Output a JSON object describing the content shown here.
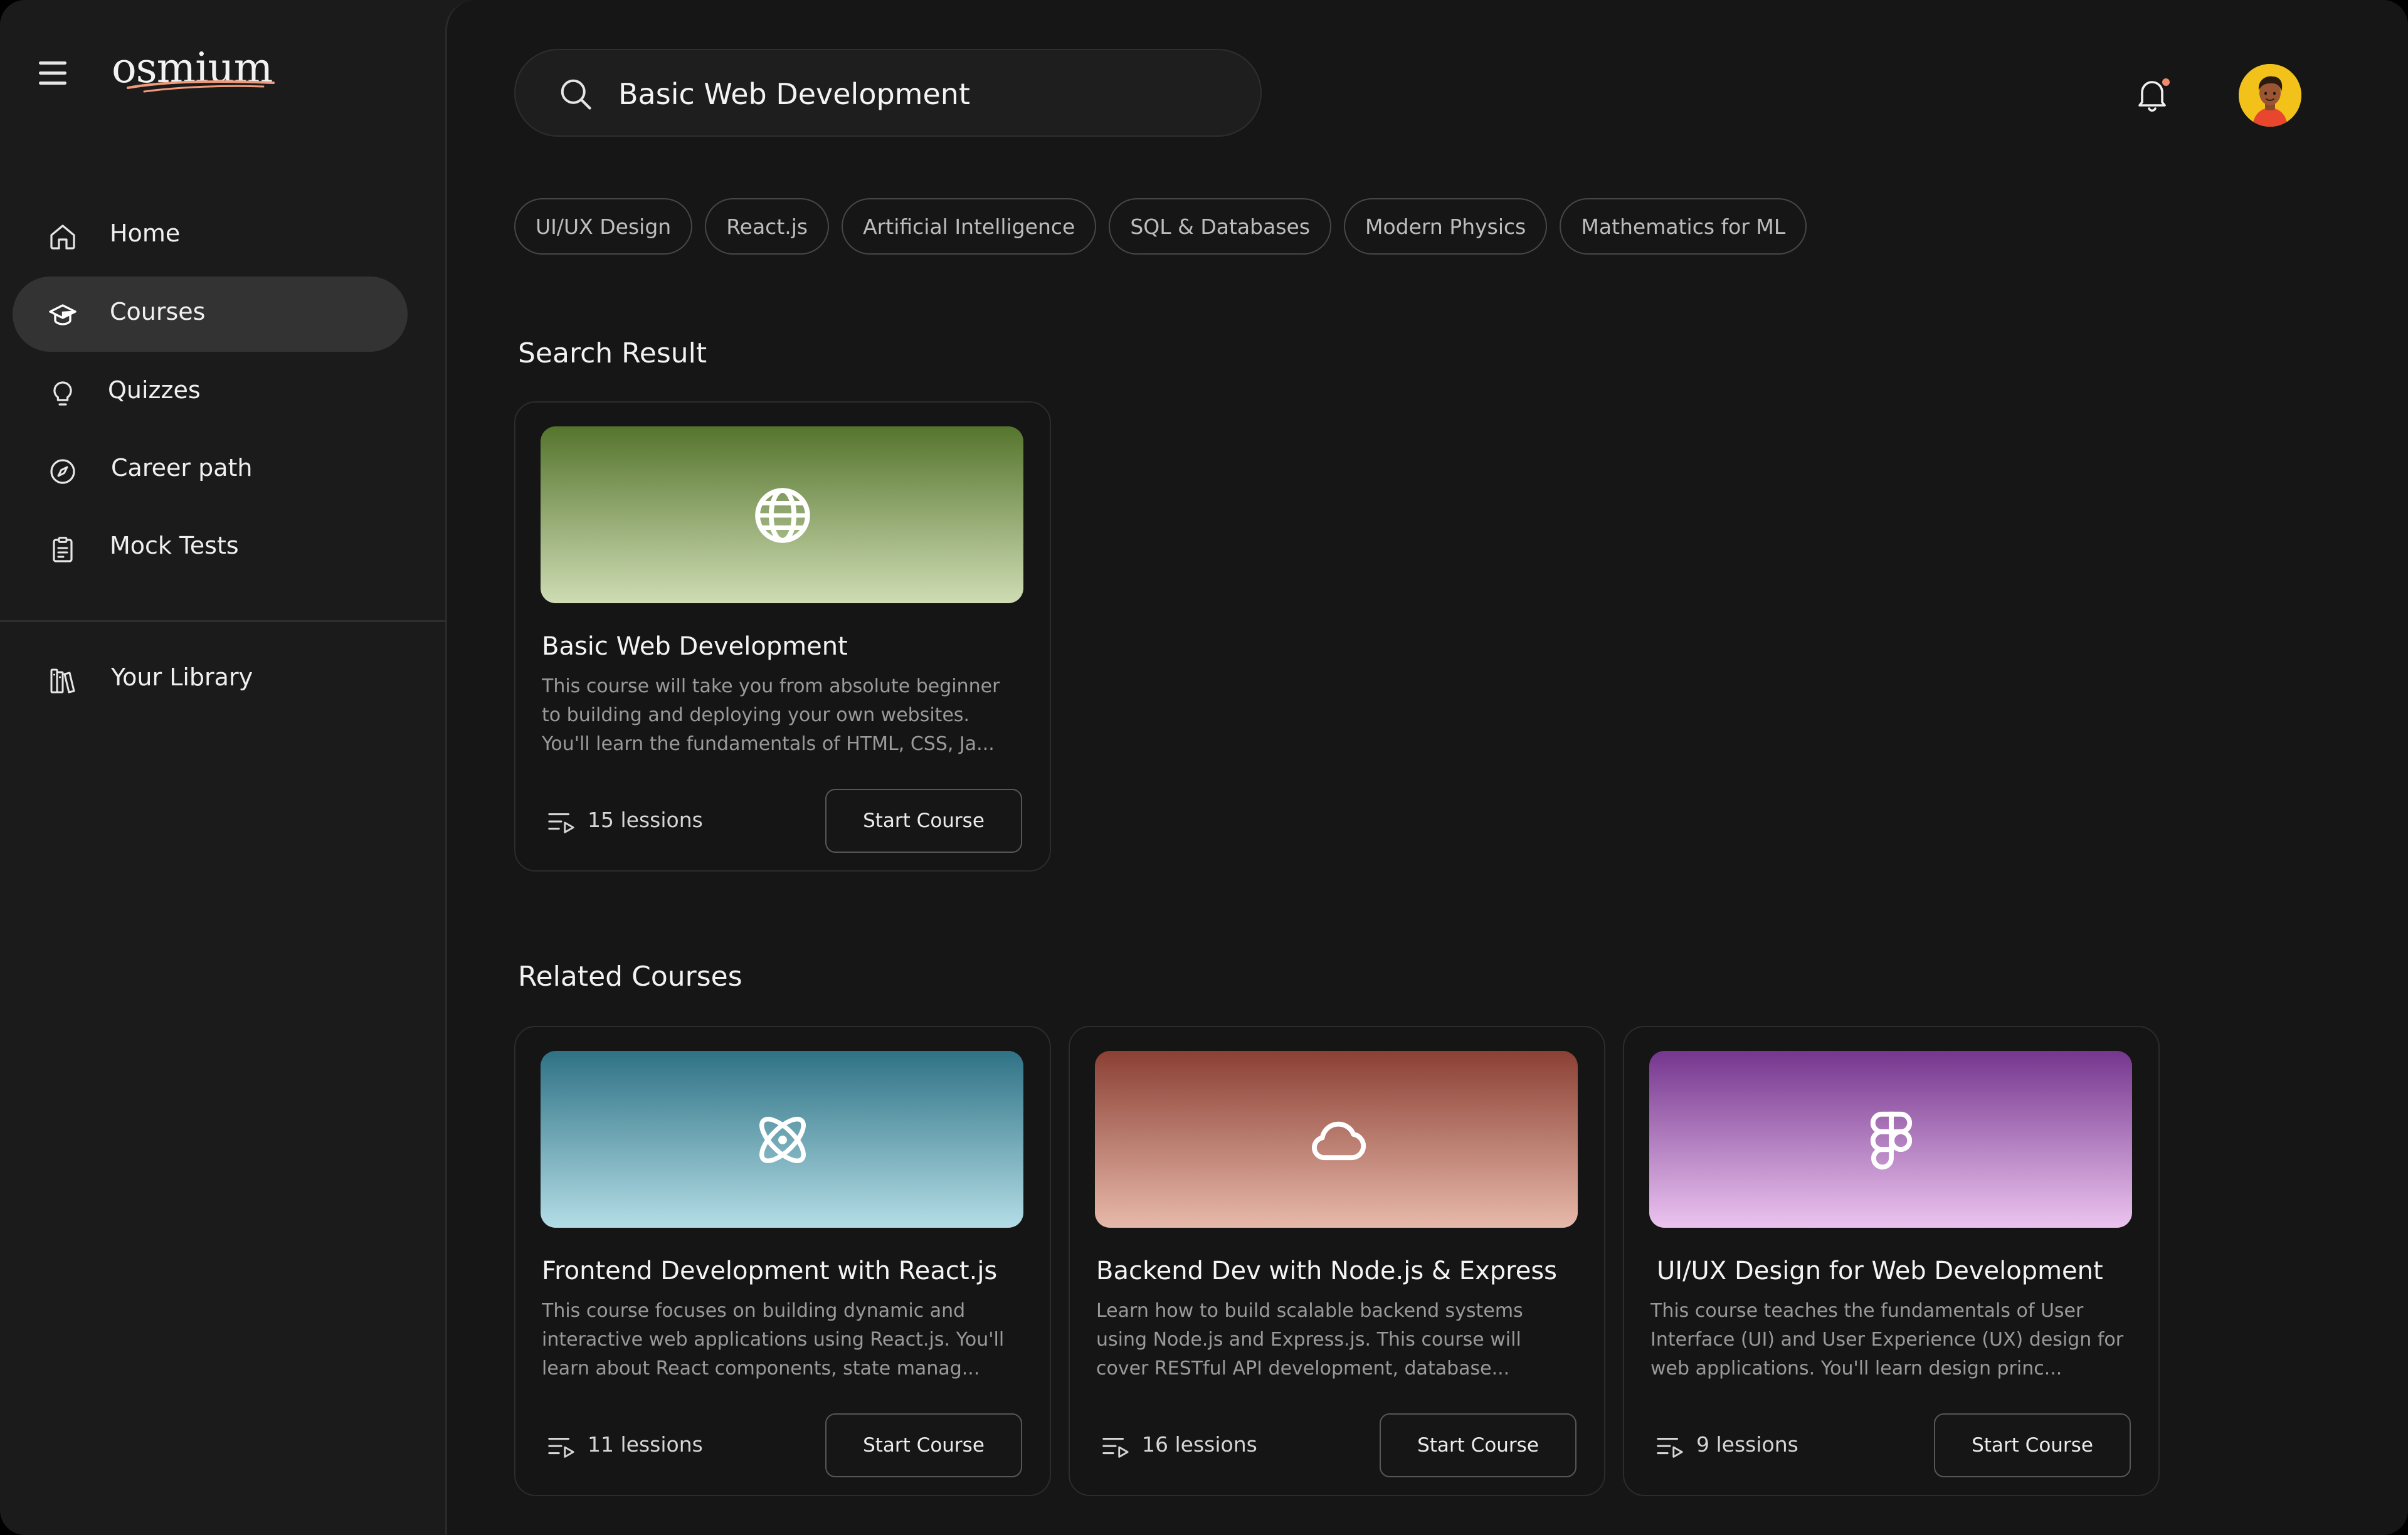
{
  "app": {
    "logo_text": "osmium",
    "brand_accent": "#f09a7c"
  },
  "sidebar": {
    "items": [
      {
        "label": "Home",
        "icon": "home-icon"
      },
      {
        "label": "Courses",
        "icon": "graduation-cap-icon",
        "active": true
      },
      {
        "label": "Quizzes",
        "icon": "lightbulb-icon"
      },
      {
        "label": "Career path",
        "icon": "compass-icon"
      },
      {
        "label": "Mock Tests",
        "icon": "clipboard-icon"
      }
    ],
    "library": {
      "label": "Your Library",
      "icon": "library-icon"
    }
  },
  "header": {
    "search_value": "Basic Web Development",
    "notification_dot_color": "#f28b6b"
  },
  "chips": [
    "UI/UX Design",
    "React.js",
    "Artificial Intelligence",
    "SQL & Databases",
    "Modern Physics",
    "Mathematics for ML"
  ],
  "search_result": {
    "heading": "Search Result",
    "cards": [
      {
        "title": "Basic Web Development",
        "desc": "This course will take you from absolute beginner to building and deploying your own websites. You'll learn the fundamentals of HTML, CSS, Ja...",
        "lessons": "15 lessions",
        "button": "Start Course",
        "icon": "globe-icon",
        "gradient": [
          "#55752d",
          "#cfdcb4"
        ]
      }
    ]
  },
  "related": {
    "heading": "Related Courses",
    "cards": [
      {
        "title": "Frontend Development with React.js",
        "desc": "This course focuses on building dynamic and interactive web applications using React.js. You'll learn about React components, state manag...",
        "lessons": "11 lessions",
        "button": "Start Course",
        "icon": "atom-icon",
        "gradient": [
          "#2f7285",
          "#b3dde6"
        ]
      },
      {
        "title": "Backend Dev with Node.js & Express",
        "desc": "Learn how to build scalable backend systems using Node.js and Express.js. This course will cover RESTful API development, database...",
        "lessons": "16 lessions",
        "button": "Start Course",
        "icon": "cloud-icon",
        "gradient": [
          "#8b4034",
          "#e7b9aa"
        ]
      },
      {
        "title": "UI/UX Design for Web Development",
        "desc": "This course teaches the fundamentals of User Interface (UI) and User Experience (UX) design for web applications. You'll learn design princ...",
        "lessons": "9 lessions",
        "button": "Start Course",
        "icon": "figma-icon",
        "gradient": [
          "#75368e",
          "#ecc4ef"
        ]
      }
    ]
  }
}
